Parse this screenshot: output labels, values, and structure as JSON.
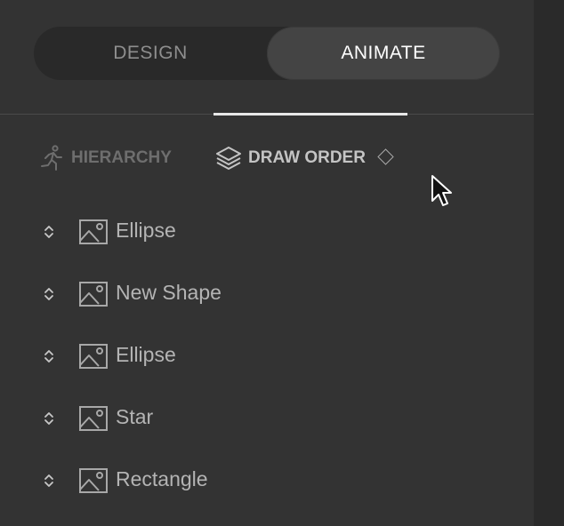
{
  "mode_toggle": {
    "design_label": "DESIGN",
    "animate_label": "ANIMATE",
    "selected": "ANIMATE"
  },
  "subtabs": {
    "hierarchy_label": "HIERARCHY",
    "draw_order_label": "DRAW ORDER",
    "active": "DRAW ORDER"
  },
  "draw_order_items": [
    {
      "label": "Ellipse",
      "icon": "image-icon"
    },
    {
      "label": "New Shape",
      "icon": "image-icon"
    },
    {
      "label": "Ellipse",
      "icon": "image-icon"
    },
    {
      "label": "Star",
      "icon": "image-icon"
    },
    {
      "label": "Rectangle",
      "icon": "image-icon"
    }
  ],
  "colors": {
    "panel_bg": "#333333",
    "toggle_bg": "#292929",
    "toggle_active_bg": "#444444",
    "active_underline": "#e8e8e8",
    "text_muted": "#8e8e8e",
    "text_item": "#b4b4b4"
  },
  "icons": {
    "hierarchy": "running-figure-icon",
    "draw_order": "stacked-layers-icon",
    "key": "diamond-keyframe-icon",
    "reorder": "drag-handle-icon",
    "cursor": "mouse-pointer-icon"
  }
}
